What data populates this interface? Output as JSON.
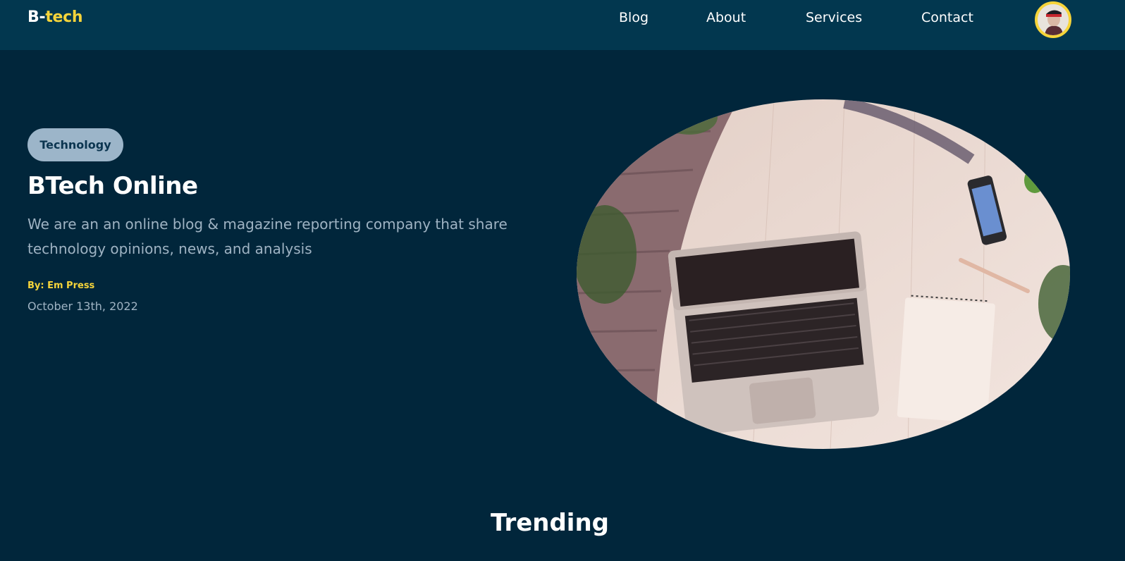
{
  "nav": {
    "logo_part1": "B-",
    "logo_part2": "tech",
    "links": [
      "Blog",
      "About",
      "Services",
      "Contact"
    ]
  },
  "hero": {
    "tag": "Technology",
    "title": "BTech Online",
    "description": "We are an an online blog & magazine reporting company that share technology opinions, news, and analysis",
    "author": "By: Em Press",
    "date": "October 13th, 2022"
  },
  "section": {
    "trending_title": "Trending"
  },
  "colors": {
    "page_bg": "#01263b",
    "nav_bg": "#02374f",
    "accent": "#f6d43a",
    "tag_bg": "#9cb5c9",
    "muted_text": "#9fb3c3"
  }
}
